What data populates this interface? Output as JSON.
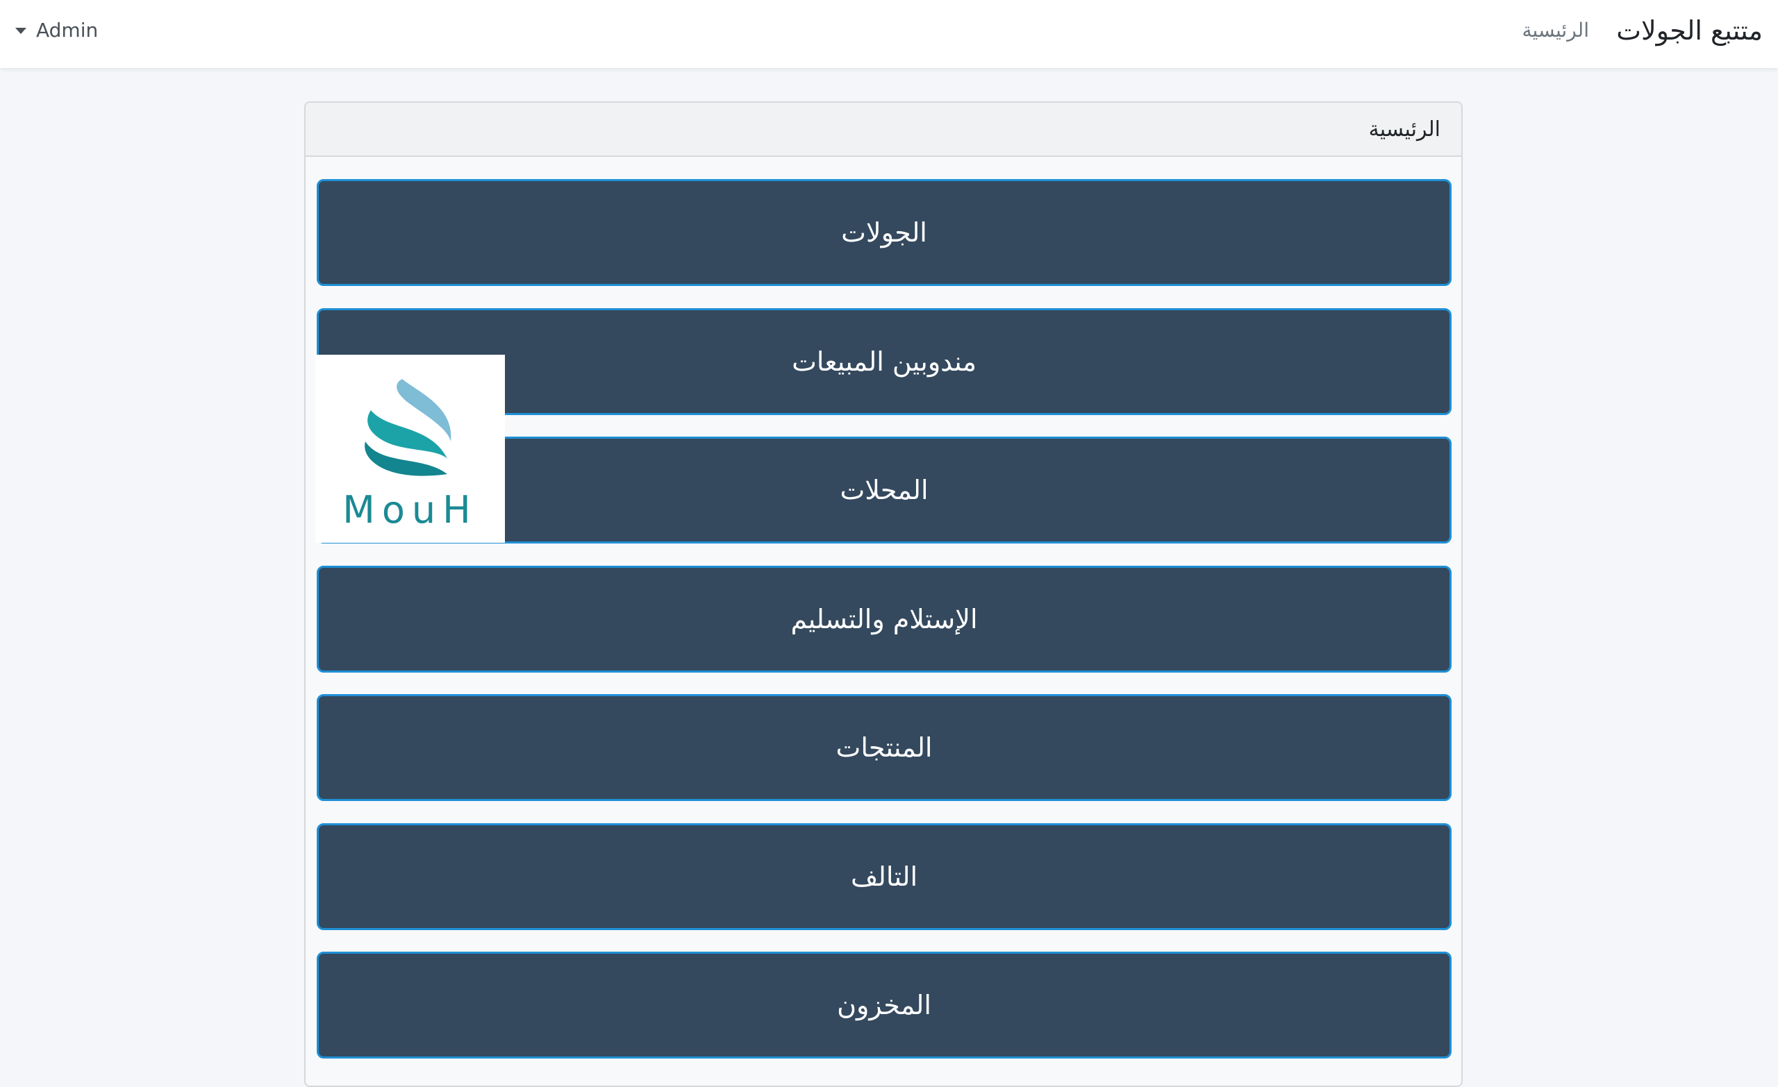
{
  "navbar": {
    "brand": "متتبع الجولات",
    "home_link": "الرئيسية",
    "user": "Admin"
  },
  "card": {
    "title": "الرئيسية",
    "buttons": [
      "الجولات",
      "مندوبين المبيعات",
      "المحلات",
      "الإستلام والتسليم",
      "المنتجات",
      "التالف",
      "المخزون"
    ]
  },
  "logo": {
    "text": "MouH",
    "colors": [
      "#7fbcd6",
      "#1ba3a8",
      "#13858f"
    ]
  }
}
